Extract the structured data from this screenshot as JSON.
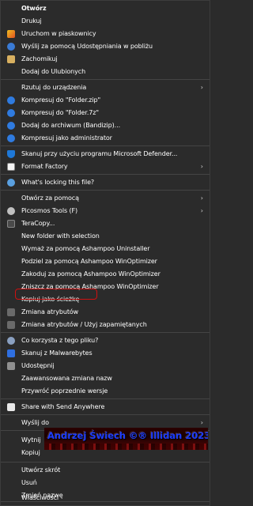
{
  "menu": {
    "items": [
      {
        "label": "Otwórz",
        "bold": true
      },
      {
        "label": "Drukuj"
      },
      {
        "label": "Uruchom w piaskownicy"
      },
      {
        "label": "Wyślij za pomocą Udostępniania w pobliżu"
      },
      {
        "label": "Zachomikuj"
      },
      {
        "label": "Dodaj do Ulubionych"
      },
      {
        "label": "Rzutuj do urządzenia"
      },
      {
        "label": "Kompresuj do \"Folder.zip\""
      },
      {
        "label": "Kompresuj do \"Folder.7z\""
      },
      {
        "label": "Dodaj do archiwum (Bandizip)..."
      },
      {
        "label": "Kompresuj jako administrator"
      },
      {
        "label": "Skanuj przy użyciu programu Microsoft Defender..."
      },
      {
        "label": "Format Factory"
      },
      {
        "label": "What's locking this file?"
      },
      {
        "label": "Otwórz za pomocą"
      },
      {
        "label": "Picosmos Tools (F)"
      },
      {
        "label": "TeraCopy..."
      },
      {
        "label": "New folder with selection"
      },
      {
        "label": "Wymaż za pomocą Ashampoo Uninstaller"
      },
      {
        "label": "Podziel za pomocą Ashampoo WinOptimizer"
      },
      {
        "label": "Zakoduj za pomocą Ashampoo WinOptimizer"
      },
      {
        "label": "Zniszcz za pomocą Ashampoo WinOptimizer"
      },
      {
        "label": "Kopiuj jako ścieżkę"
      },
      {
        "label": "Zmiana atrybutów"
      },
      {
        "label": "Zmiana atrybutów / Użyj zapamiętanych"
      },
      {
        "label": "Co korzysta z tego pliku?"
      },
      {
        "label": "Skanuj z Malwarebytes"
      },
      {
        "label": "Udostępnij"
      },
      {
        "label": "Zaawansowana zmiana nazw"
      },
      {
        "label": "Przywróć poprzednie wersje"
      },
      {
        "label": "Share with Send Anywhere"
      },
      {
        "label": "Wyślij do"
      },
      {
        "label": "Wytnij"
      },
      {
        "label": "Kopiuj"
      },
      {
        "label": "Utwórz skrót"
      },
      {
        "label": "Usuń"
      },
      {
        "label": "Zmień nazwę"
      },
      {
        "label": "Właściwości"
      }
    ]
  },
  "watermark": {
    "text": "Andrzej Świech ©® Illidan 2023"
  },
  "colors": {
    "background": "#2b2b2b",
    "text": "#ffffff",
    "highlight_border": "#d01010",
    "separator": "#444444"
  }
}
